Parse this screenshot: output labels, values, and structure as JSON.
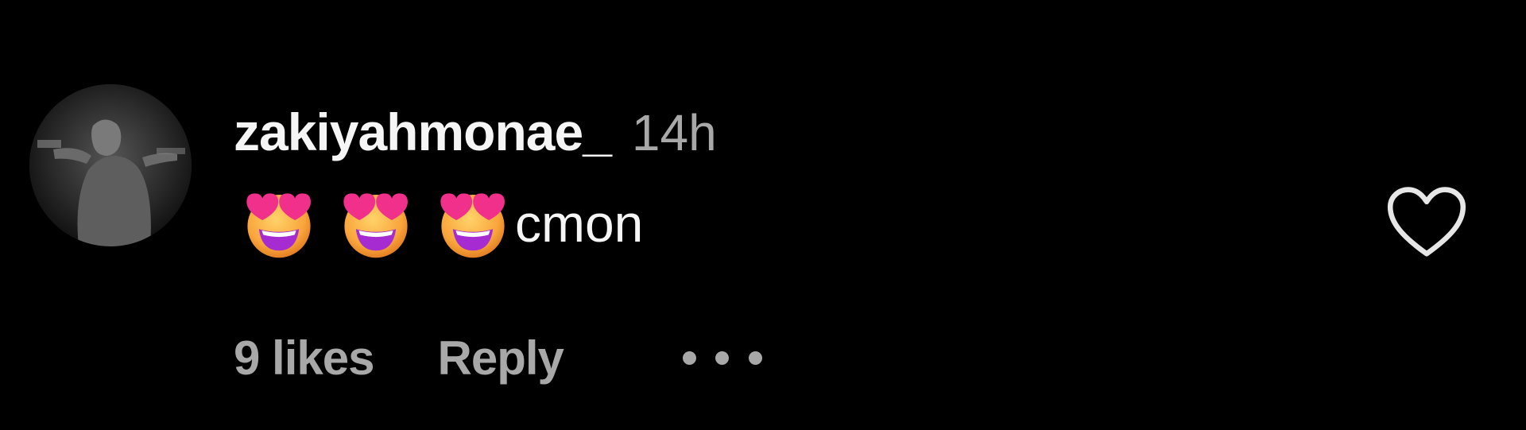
{
  "comment": {
    "username": "zakiyahmonae_",
    "timestamp": "14h",
    "emojis": [
      "smiling-face-with-heart-eyes",
      "smiling-face-with-heart-eyes",
      "smiling-face-with-heart-eyes"
    ],
    "text": "cmon",
    "likes_label": "9 likes",
    "reply_label": "Reply",
    "more_icon": "more-horizontal-icon",
    "like_icon": "heart-outline-icon"
  },
  "colors": {
    "background": "#000000",
    "primary_text": "#f5f5f5",
    "secondary_text": "#a8a8a8"
  }
}
